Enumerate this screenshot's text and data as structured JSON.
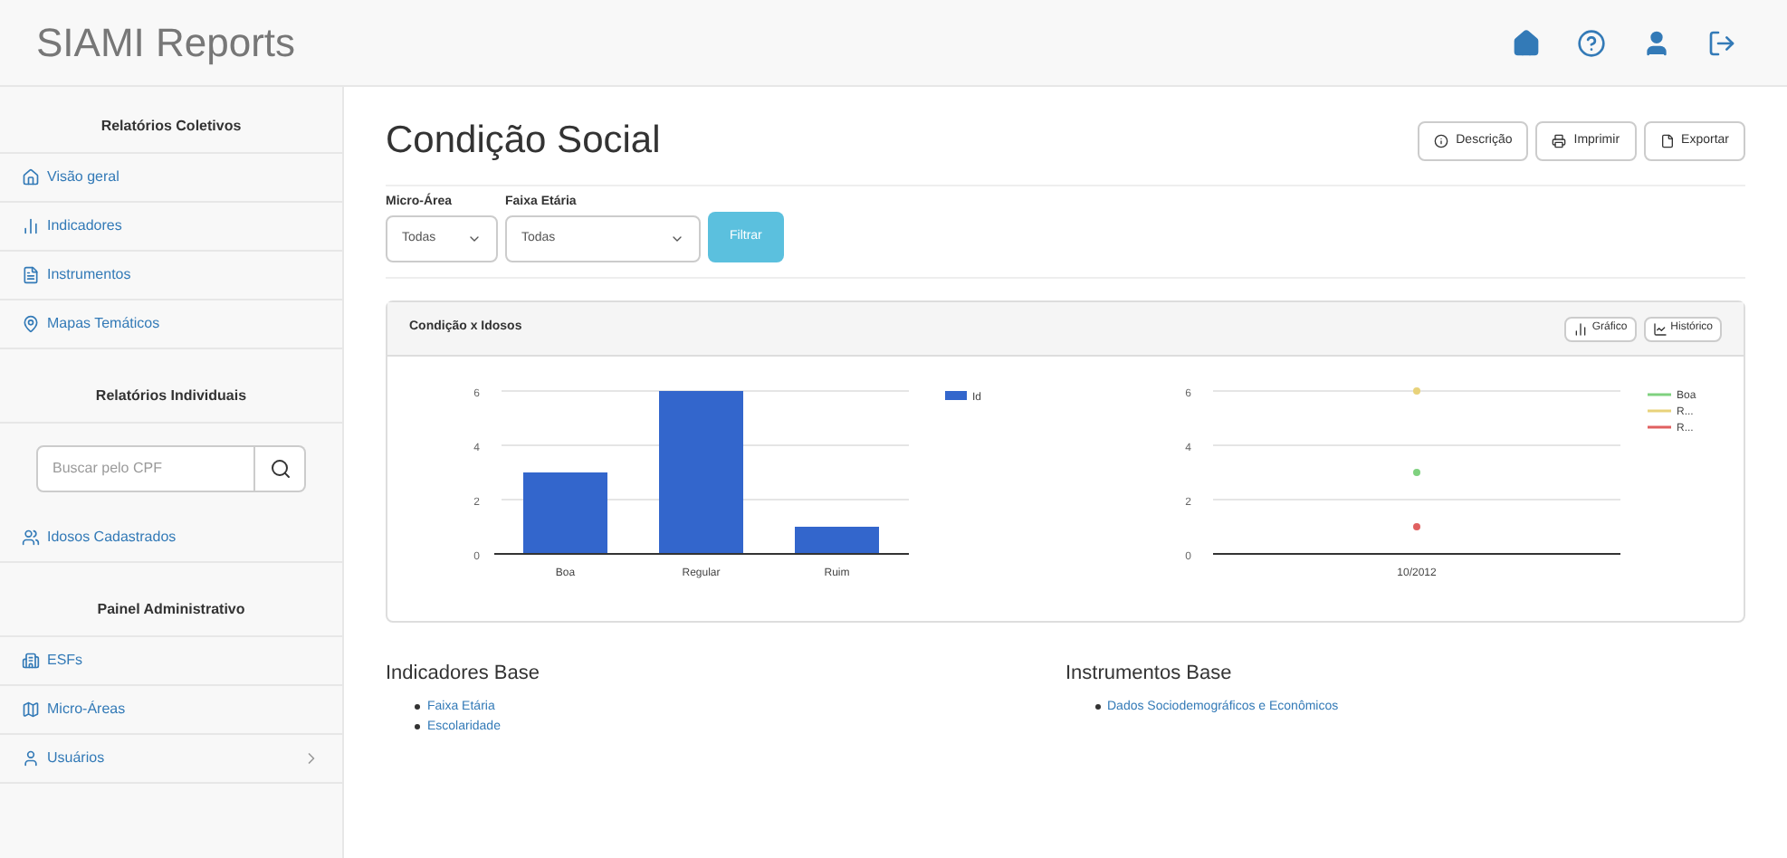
{
  "navbar": {
    "brand": "SIAMI Reports"
  },
  "sidebar": {
    "sections": [
      {
        "title": "Relatórios Coletivos",
        "items": [
          {
            "label": "Visão geral",
            "expandable": false
          },
          {
            "label": "Indicadores",
            "expandable": false
          },
          {
            "label": "Instrumentos",
            "expandable": false
          },
          {
            "label": "Mapas Temáticos",
            "expandable": false
          }
        ]
      },
      {
        "title": "Relatórios Individuais",
        "search": {
          "placeholder": "Buscar pelo CPF"
        },
        "items": [
          {
            "label": "Idosos Cadastrados",
            "expandable": false
          }
        ]
      },
      {
        "title": "Painel Administrativo",
        "items": [
          {
            "label": "ESFs",
            "expandable": false
          },
          {
            "label": "Micro-Áreas",
            "expandable": false
          },
          {
            "label": "Usuários",
            "expandable": true
          }
        ]
      }
    ]
  },
  "page": {
    "title": "Condição Social",
    "actions": [
      "Descrição",
      "Imprimir",
      "Exportar"
    ]
  },
  "filters": [
    {
      "label": "Micro-Área",
      "value": "Todas"
    },
    {
      "label": "Faixa Etária",
      "value": "Todas"
    }
  ],
  "filter_button": "Filtrar",
  "panel": {
    "title": "Condição x Idosos",
    "tools": [
      "Gráfico",
      "Histórico"
    ],
    "bar_chart": {
      "chart_data": {
        "type": "bar",
        "categories": [
          "Boa",
          "Regular",
          "Ruim"
        ],
        "series": [
          {
            "name": "Id",
            "color": "#3366cc",
            "values": [
              3,
              6,
              1
            ]
          }
        ],
        "ylim": [
          0,
          6
        ],
        "yticks": [
          0,
          2,
          4,
          6
        ],
        "legend": "right"
      }
    },
    "line_chart": {
      "chart_data": {
        "type": "line",
        "x": [
          "10/2012"
        ],
        "series": [
          {
            "name": "Boa",
            "color": "#7fd17f",
            "values": [
              3
            ],
            "marker": "circle"
          },
          {
            "name": "R...",
            "color": "#e8d27a",
            "values": [
              6
            ],
            "marker": "circle"
          },
          {
            "name": "R...",
            "color": "#e06060",
            "values": [
              1
            ],
            "marker": "circle"
          }
        ],
        "ylim": [
          0,
          6
        ],
        "yticks": [
          0,
          2,
          4,
          6
        ],
        "legend": "right"
      }
    }
  },
  "lists": [
    {
      "title": "Indicadores Base",
      "links": [
        "Faixa Etária",
        "Escolaridade"
      ]
    },
    {
      "title": "Instrumentos Base",
      "links": [
        "Dados Sociodemográficos e Econômicos"
      ]
    }
  ]
}
